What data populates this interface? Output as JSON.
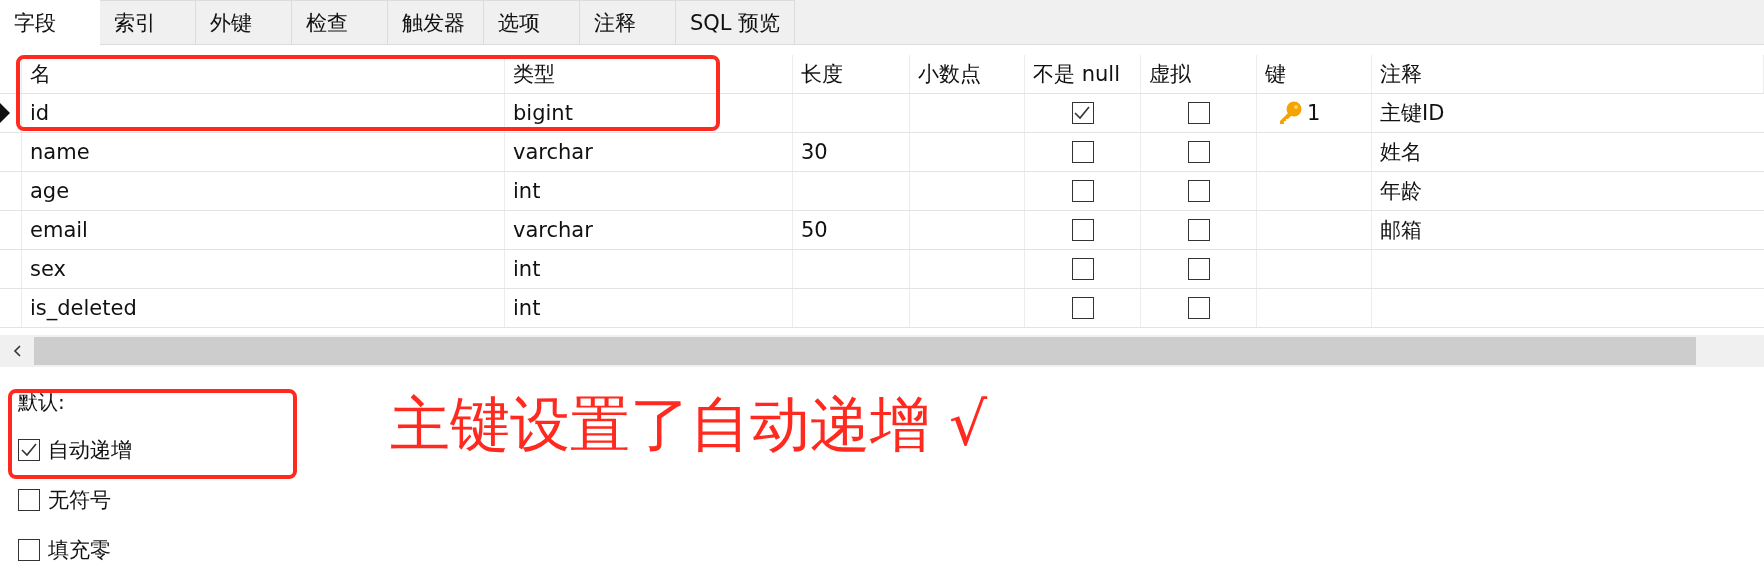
{
  "tabs": [
    {
      "label": "字段",
      "selected": true
    },
    {
      "label": "索引",
      "selected": false
    },
    {
      "label": "外键",
      "selected": false
    },
    {
      "label": "检查",
      "selected": false
    },
    {
      "label": "触发器",
      "selected": false
    },
    {
      "label": "选项",
      "selected": false
    },
    {
      "label": "注释",
      "selected": false
    },
    {
      "label": "SQL 预览",
      "selected": false
    }
  ],
  "table": {
    "columns": [
      "名",
      "类型",
      "长度",
      "小数点",
      "不是 null",
      "虚拟",
      "键",
      "注释"
    ],
    "rows": [
      {
        "name": "id",
        "type": "bigint",
        "not_null": true,
        "virtual": false,
        "key": "1",
        "comment": "主键ID",
        "selected": true
      },
      {
        "name": "name",
        "type": "varchar",
        "length": "30",
        "not_null": false,
        "virtual": false,
        "comment": "姓名",
        "selected": false
      },
      {
        "name": "age",
        "type": "int",
        "not_null": false,
        "virtual": false,
        "comment": "年龄",
        "selected": false
      },
      {
        "name": "email",
        "type": "varchar",
        "length": "50",
        "not_null": false,
        "virtual": false,
        "comment": "邮箱",
        "selected": false
      },
      {
        "name": "sex",
        "type": "int",
        "not_null": false,
        "virtual": false,
        "selected": false
      },
      {
        "name": "is_deleted",
        "type": "int",
        "not_null": false,
        "virtual": false,
        "selected": false
      }
    ]
  },
  "options": {
    "title": "默认:",
    "items": [
      {
        "label": "自动递增",
        "checked": true
      },
      {
        "label": "无符号",
        "checked": false
      },
      {
        "label": "填充零",
        "checked": false
      }
    ]
  },
  "annotation": {
    "text": "主键设置了自动递增 √"
  }
}
